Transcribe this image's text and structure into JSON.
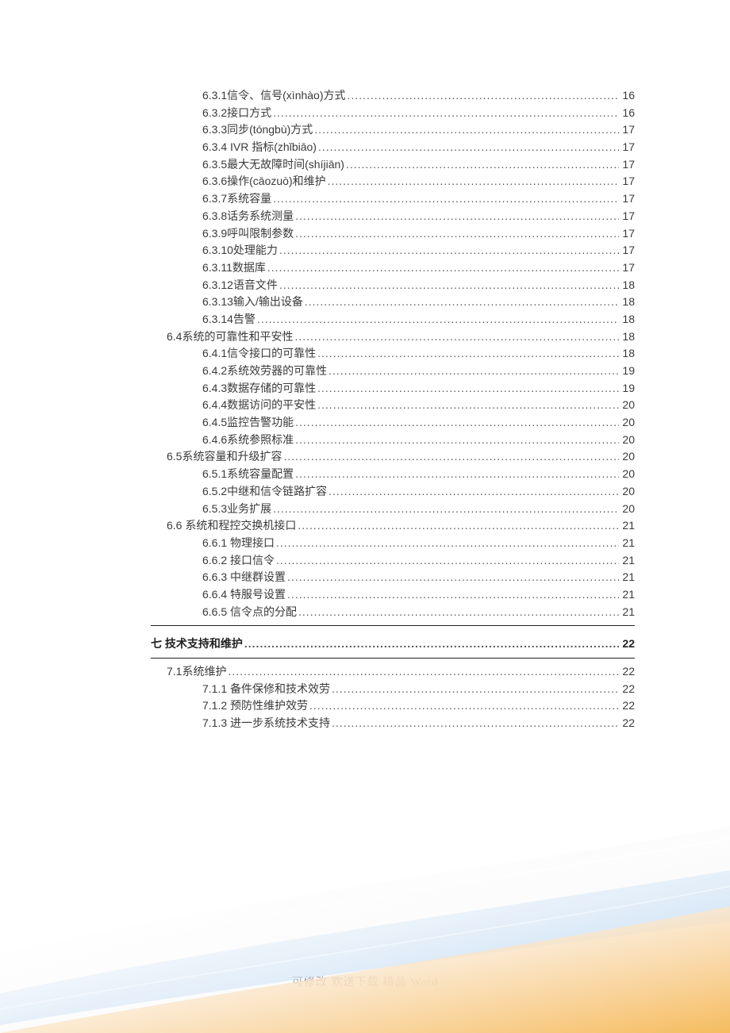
{
  "toc": [
    {
      "level": 2,
      "text": "6.3.1信令、信号(xìnhào)方式",
      "page": "16"
    },
    {
      "level": 2,
      "text": "6.3.2接口方式",
      "page": "16"
    },
    {
      "level": 2,
      "text": "6.3.3同步(tóngbù)方式",
      "page": "17"
    },
    {
      "level": 2,
      "text": "6.3.4 IVR 指标(zhǐbiāo)",
      "page": "17"
    },
    {
      "level": 2,
      "text": "6.3.5最大无故障时间(shíjiān)",
      "page": "17"
    },
    {
      "level": 2,
      "text": "6.3.6操作(cāozuò)和维护",
      "page": "17"
    },
    {
      "level": 2,
      "text": "6.3.7系统容量",
      "page": "17"
    },
    {
      "level": 2,
      "text": "6.3.8话务系统测量",
      "page": "17"
    },
    {
      "level": 2,
      "text": "6.3.9呼叫限制参数",
      "page": "17"
    },
    {
      "level": 2,
      "text": "6.3.10处理能力",
      "page": "17"
    },
    {
      "level": 2,
      "text": "6.3.11数据库",
      "page": "17"
    },
    {
      "level": 2,
      "text": "6.3.12语音文件",
      "page": "18"
    },
    {
      "level": 2,
      "text": "6.3.13输入/输出设备",
      "page": "18"
    },
    {
      "level": 2,
      "text": "6.3.14告警",
      "page": "18"
    },
    {
      "level": 1,
      "text": "6.4系统的可靠性和平安性",
      "page": "18"
    },
    {
      "level": 2,
      "text": "6.4.1信令接口的可靠性",
      "page": "18"
    },
    {
      "level": 2,
      "text": "6.4.2系统效劳器的可靠性",
      "page": "19"
    },
    {
      "level": 2,
      "text": "6.4.3数据存储的可靠性",
      "page": "19"
    },
    {
      "level": 2,
      "text": "6.4.4数据访问的平安性",
      "page": "20"
    },
    {
      "level": 2,
      "text": "6.4.5监控告警功能",
      "page": "20"
    },
    {
      "level": 2,
      "text": "6.4.6系统参照标准",
      "page": "20"
    },
    {
      "level": 1,
      "text": "6.5系统容量和升级扩容",
      "page": "20"
    },
    {
      "level": 2,
      "text": "6.5.1系统容量配置",
      "page": "20"
    },
    {
      "level": 2,
      "text": "6.5.2中继和信令链路扩容",
      "page": "20"
    },
    {
      "level": 2,
      "text": "6.5.3业务扩展",
      "page": "20"
    },
    {
      "level": 1,
      "text": "6.6 系统和程控交换机接口",
      "page": "21"
    },
    {
      "level": 2,
      "text": "6.6.1 物理接口",
      "page": "21"
    },
    {
      "level": 2,
      "text": "6.6.2 接口信令",
      "page": "21"
    },
    {
      "level": 2,
      "text": "6.6.3 中继群设置",
      "page": "21"
    },
    {
      "level": 2,
      "text": "6.6.4 特服号设置",
      "page": "21"
    },
    {
      "level": 2,
      "text": "6.6.5 信令点的分配",
      "page": "21"
    },
    {
      "level": "section",
      "text": "七 技术支持和维护",
      "page": "22"
    },
    {
      "level": 1,
      "text": "7.1系统维护",
      "page": "22"
    },
    {
      "level": 2,
      "text": "7.1.1 备件保修和技术效劳",
      "page": "22"
    },
    {
      "level": 2,
      "text": "7.1.2 预防性维护效劳",
      "page": "22"
    },
    {
      "level": 2,
      "text": "7.1.3 进一步系统技术支持",
      "page": "22"
    }
  ],
  "footer": {
    "cn": "可修改 欢送下载 精品 ",
    "en": "Word"
  }
}
